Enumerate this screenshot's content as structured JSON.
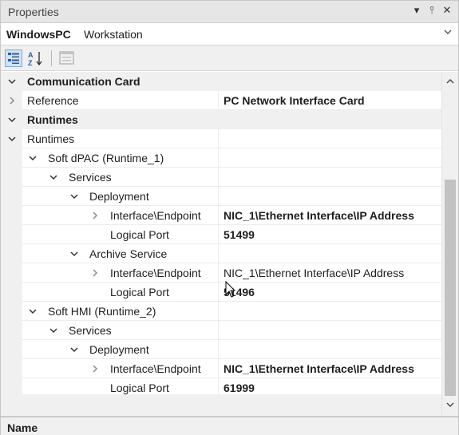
{
  "panel": {
    "title": "Properties",
    "buttons": [
      "▾",
      "⫯",
      "✕"
    ]
  },
  "object_selector": {
    "name": "WindowsPC",
    "type": "Workstation"
  },
  "toolbar": {
    "categorized_icon": "categorized-icon",
    "alphabetical_icon": "alphabetical-sort-icon",
    "property_pages_icon": "property-pages-icon"
  },
  "rows": [
    {
      "kind": "category",
      "expander": "down",
      "indent": 0,
      "label": "Communication Card",
      "value": "",
      "value_bold": false
    },
    {
      "kind": "property",
      "expander": "right",
      "indent": 0,
      "label": "Reference",
      "value": "PC Network Interface Card",
      "value_bold": true
    },
    {
      "kind": "category",
      "expander": "down",
      "indent": 0,
      "label": "Runtimes",
      "value": "",
      "value_bold": false
    },
    {
      "kind": "property",
      "expander": "down",
      "indent": 0,
      "label": "Runtimes",
      "value": "",
      "value_bold": false
    },
    {
      "kind": "property",
      "expander": "down",
      "indent": 1,
      "label": "Soft dPAC (Runtime_1)",
      "value": "",
      "value_bold": false
    },
    {
      "kind": "property",
      "expander": "down",
      "indent": 2,
      "label": "Services",
      "value": "",
      "value_bold": false
    },
    {
      "kind": "property",
      "expander": "down",
      "indent": 3,
      "label": "Deployment",
      "value": "",
      "value_bold": false
    },
    {
      "kind": "property",
      "expander": "right",
      "indent": 4,
      "label": "Interface\\Endpoint",
      "value": "NIC_1\\Ethernet Interface\\IP Address",
      "value_bold": true
    },
    {
      "kind": "property",
      "expander": "none",
      "indent": 4,
      "label": "Logical Port",
      "value": "51499",
      "value_bold": true
    },
    {
      "kind": "property",
      "expander": "down",
      "indent": 3,
      "label": "Archive Service",
      "value": "",
      "value_bold": false
    },
    {
      "kind": "property",
      "expander": "right",
      "indent": 4,
      "label": "Interface\\Endpoint",
      "value": "NIC_1\\Ethernet Interface\\IP Address",
      "value_bold": false
    },
    {
      "kind": "property",
      "expander": "none",
      "indent": 4,
      "label": "Logical Port",
      "value": "51496",
      "value_bold": true
    },
    {
      "kind": "property",
      "expander": "down",
      "indent": 1,
      "label": "Soft HMI (Runtime_2)",
      "value": "",
      "value_bold": false
    },
    {
      "kind": "property",
      "expander": "down",
      "indent": 2,
      "label": "Services",
      "value": "",
      "value_bold": false
    },
    {
      "kind": "property",
      "expander": "down",
      "indent": 3,
      "label": "Deployment",
      "value": "",
      "value_bold": false
    },
    {
      "kind": "property",
      "expander": "right",
      "indent": 4,
      "label": "Interface\\Endpoint",
      "value": "NIC_1\\Ethernet Interface\\IP Address",
      "value_bold": true
    },
    {
      "kind": "property",
      "expander": "none",
      "indent": 4,
      "label": "Logical Port",
      "value": "61999",
      "value_bold": true
    }
  ],
  "description": {
    "name": "Name"
  },
  "colors": {
    "category_bg": "#f0f0f0",
    "selected_toolbar_bg": "#cfe3f7",
    "scroll_thumb": "#c2c2c2"
  }
}
